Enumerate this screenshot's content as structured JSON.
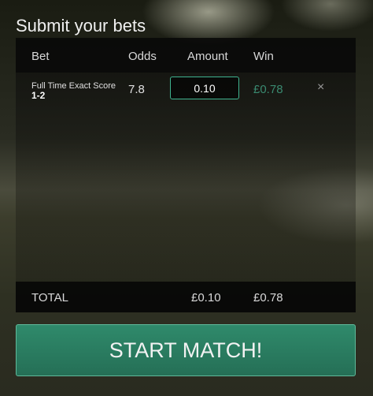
{
  "page": {
    "title": "Submit your bets"
  },
  "table": {
    "headers": {
      "bet": "Bet",
      "odds": "Odds",
      "amount": "Amount",
      "win": "Win"
    },
    "rows": [
      {
        "market": "Full Time Exact Score",
        "selection": "1-2",
        "odds": "7.8",
        "amount": "0.10",
        "win": "£0.78",
        "remove_icon": "close-icon",
        "remove_glyph": "×"
      }
    ],
    "totals": {
      "label": "TOTAL",
      "amount": "£0.10",
      "win": "£0.78"
    }
  },
  "actions": {
    "start_label": "START MATCH!"
  },
  "colors": {
    "accent": "#2f8a6b",
    "win_text": "#3a8a70",
    "input_border": "#3fb38f"
  }
}
